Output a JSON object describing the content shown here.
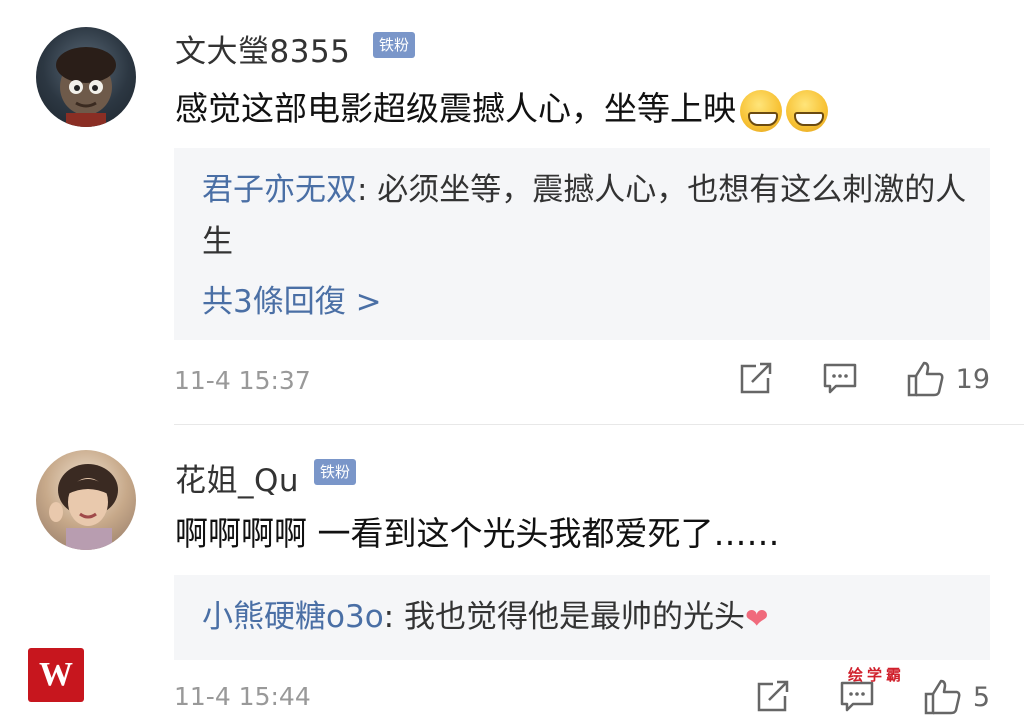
{
  "comments": [
    {
      "username": "文大瑩8355",
      "badge": "铁粉",
      "content": "感觉这部电影超级震撼人心，坐等上映",
      "emoji_count": 2,
      "reply": {
        "author": "君子亦无双",
        "text": ": 必须坐等，震撼人心，也想有这么刺激的人生"
      },
      "more_replies": "共3條回復 >",
      "timestamp": "11-4 15:37",
      "likes": "19"
    },
    {
      "username": "花姐_Qu",
      "badge": "铁粉",
      "content": "啊啊啊啊 一看到这个光头我都爱死了……",
      "reply": {
        "author": "小熊硬糖o3o",
        "text": ": 我也觉得他是最帅的光头"
      },
      "timestamp": "11-4 15:44",
      "likes": "5"
    }
  ],
  "watermark": {
    "logo": "W",
    "text": "绘学霸"
  },
  "colors": {
    "link": "#4a6fa5",
    "badge": "#7a96c9",
    "reply_bg": "#f5f6f8",
    "meta": "#999999"
  }
}
